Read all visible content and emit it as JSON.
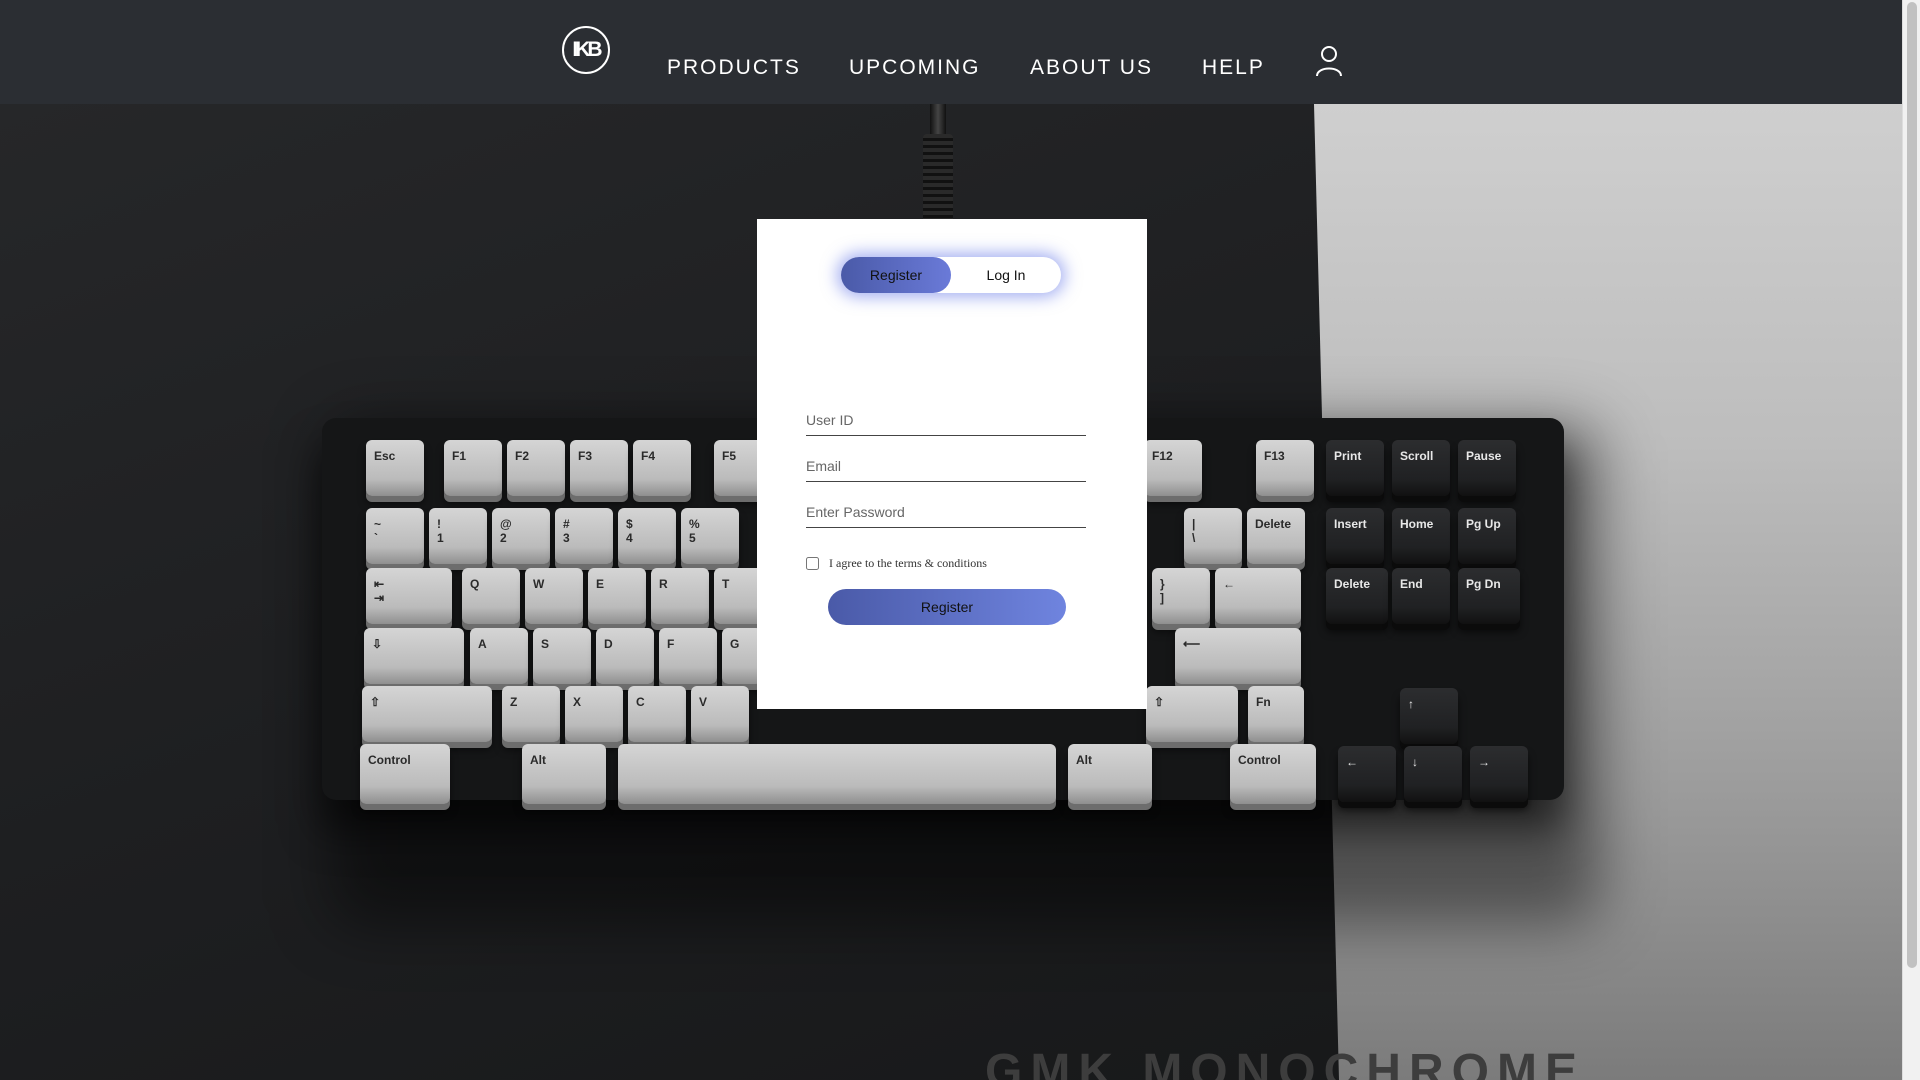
{
  "header": {
    "logo_text": "IKB",
    "nav": [
      "PRODUCTS",
      "UPCOMING",
      "ABOUT US",
      "HELP"
    ],
    "user_icon": "user-icon"
  },
  "hero": {
    "title": "GMK MONOCHROME",
    "keys_light": [
      "Esc",
      "F1",
      "F2",
      "F3",
      "F4",
      "F5",
      "F12",
      "F13",
      "~\n`",
      "!\n1",
      "@\n2",
      "#\n3",
      "$\n4",
      "%\n5",
      "|\n\\",
      "Delete",
      "⇤\n⇥",
      "Q",
      "W",
      "E",
      "R",
      "T",
      "}\n]",
      "←",
      "⇩",
      "A",
      "S",
      "D",
      "F",
      "G",
      "⟵",
      "⇧",
      "Z",
      "X",
      "C",
      "V",
      "⇧",
      "Fn",
      "Control",
      "Alt",
      "",
      "Alt",
      "Control"
    ],
    "keys_dark": [
      "Print",
      "Scroll",
      "Pause",
      "Insert",
      "Home",
      "Pg Up",
      "Delete",
      "End",
      "Pg Dn",
      "↑",
      "←",
      "↓",
      "→"
    ]
  },
  "auth": {
    "tabs": {
      "register": "Register",
      "login": "Log In"
    },
    "fields": {
      "user_id": {
        "placeholder": "User ID",
        "value": ""
      },
      "email": {
        "placeholder": "Email",
        "value": ""
      },
      "password": {
        "placeholder": "Enter Password",
        "value": ""
      }
    },
    "agree_label": "I agree to the terms & conditions",
    "submit_label": "Register"
  },
  "colors": {
    "header_bg": "#2b2e33",
    "accent_from": "#4a5aa8",
    "accent_to": "#6f84df"
  }
}
